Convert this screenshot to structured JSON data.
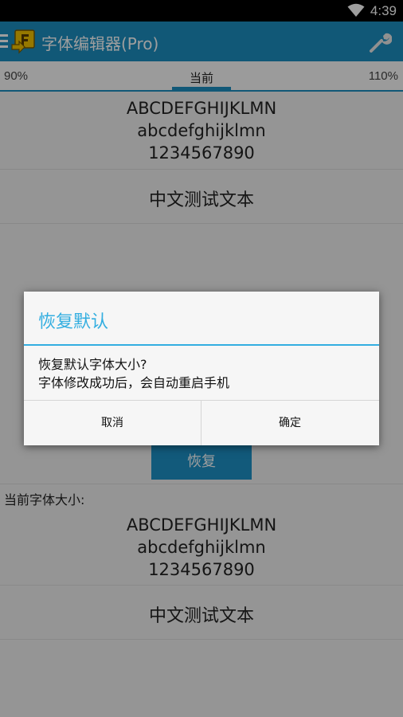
{
  "status": {
    "time": "4:39"
  },
  "actionbar": {
    "title": "字体编辑器(Pro)"
  },
  "tabs": {
    "left": "90%",
    "current": "当前",
    "right": "110%"
  },
  "preview_top": {
    "line1": "ABCDEFGHIJKLMN",
    "line2": "abcdefghijklmn",
    "line3": "1234567890",
    "chinese": "中文测试文本"
  },
  "restore_button": "恢复",
  "current_label": "当前字体大小:",
  "preview_bottom": {
    "line1": "ABCDEFGHIJKLMN",
    "line2": "abcdefghijklmn",
    "line3": "1234567890",
    "chinese": "中文测试文本"
  },
  "dialog": {
    "title": "恢复默认",
    "message1": "恢复默认字体大小?",
    "message2": "字体修改成功后，会自动重启手机",
    "cancel": "取消",
    "ok": "确定"
  },
  "colors": {
    "accent": "#1c8fc1",
    "dialog_title": "#33aee0"
  }
}
